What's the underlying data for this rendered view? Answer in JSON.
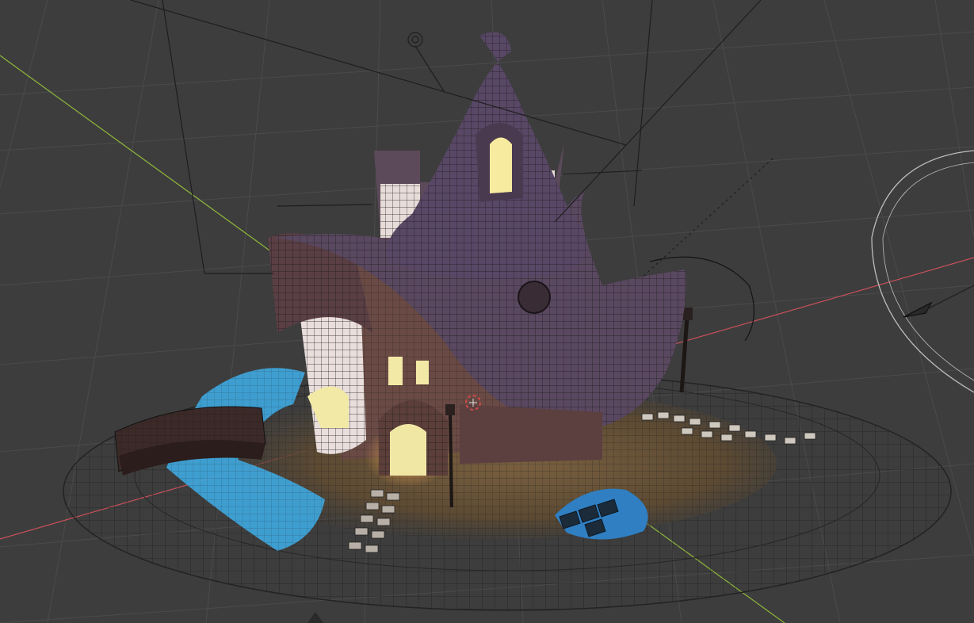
{
  "viewport": {
    "mode": "wireframe-overlay",
    "background": "#3d3d3d",
    "grid_color": "#4a4a4a",
    "axis_x_color": "#c8505a",
    "axis_y_color": "#8fb63a"
  },
  "objects": [
    {
      "name": "wizard-house",
      "kind": "mesh"
    },
    {
      "name": "terrain-disc",
      "kind": "mesh"
    },
    {
      "name": "stream",
      "kind": "mesh",
      "color": "#3fa9e0"
    },
    {
      "name": "pond",
      "kind": "mesh",
      "color": "#2f7fc2"
    },
    {
      "name": "bridge",
      "kind": "mesh"
    },
    {
      "name": "street-lamps",
      "kind": "mesh"
    },
    {
      "name": "camera",
      "kind": "camera"
    },
    {
      "name": "lights",
      "kind": "light"
    }
  ],
  "colors": {
    "roof": "#5a4860",
    "roof_dark": "#3b2f42",
    "wall": "#6a4a44",
    "tower": "#e9dedc",
    "window_glow": "#f3e9a6",
    "ground": "#6b5538",
    "wire": "#1c1c1c"
  }
}
